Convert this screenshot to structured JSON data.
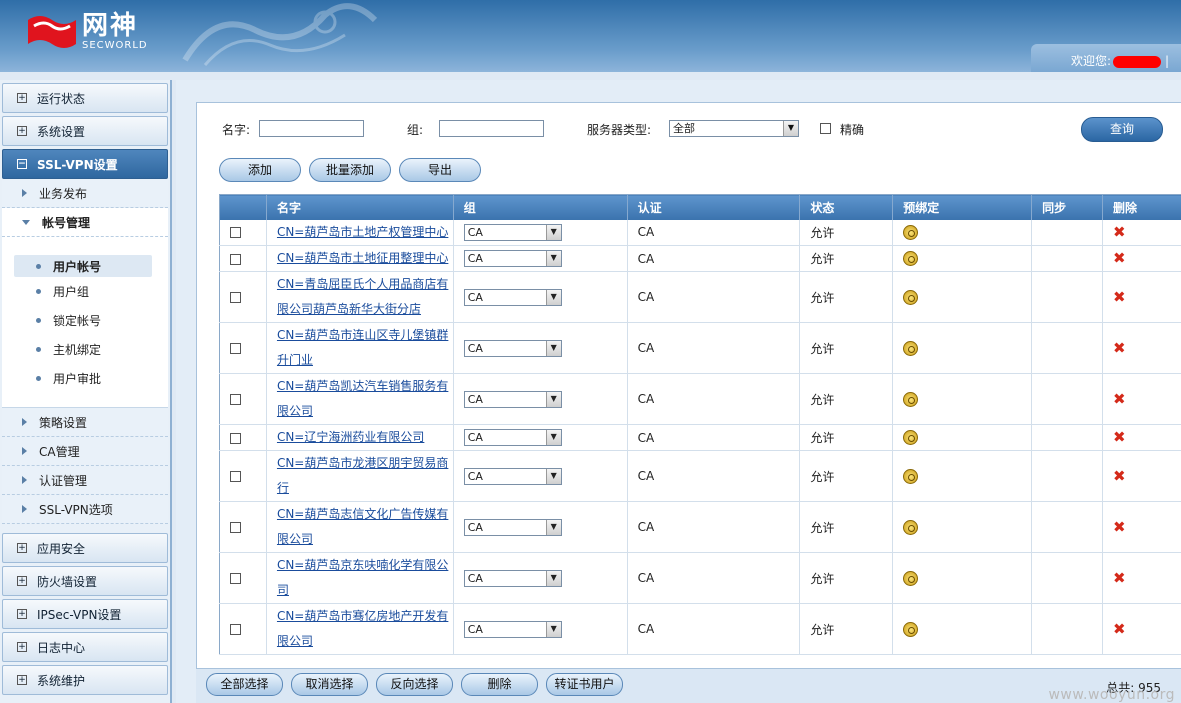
{
  "header": {
    "logo_cn": "网神",
    "logo_en": "SECWORLD",
    "welcome": "欢迎您:",
    "sep": "|"
  },
  "sidebar": {
    "groups_top": [
      {
        "label": "运行状态"
      },
      {
        "label": "系统设置"
      },
      {
        "label": "SSL-VPN设置"
      }
    ],
    "sub_top": [
      {
        "label": "业务发布"
      },
      {
        "label": "帐号管理"
      }
    ],
    "leaves": [
      {
        "label": "用户帐号"
      },
      {
        "label": "用户组"
      },
      {
        "label": "锁定帐号"
      },
      {
        "label": "主机绑定"
      },
      {
        "label": "用户审批"
      }
    ],
    "sub_bottom": [
      {
        "label": "策略设置"
      },
      {
        "label": "CA管理"
      },
      {
        "label": "认证管理"
      },
      {
        "label": "SSL-VPN选项"
      }
    ],
    "groups_bottom": [
      {
        "label": "应用安全"
      },
      {
        "label": "防火墙设置"
      },
      {
        "label": "IPSec-VPN设置"
      },
      {
        "label": "日志中心"
      },
      {
        "label": "系统维护"
      }
    ]
  },
  "search": {
    "name_label": "名字:",
    "group_label": "组:",
    "server_type_label": "服务器类型:",
    "server_type_value": "全部",
    "exact_label": "精确",
    "query_button": "查询"
  },
  "toolbar": {
    "add": "添加",
    "batch_add": "批量添加",
    "export": "导出"
  },
  "table": {
    "headers": [
      "名字",
      "组",
      "认证",
      "状态",
      "预绑定",
      "同步",
      "删除"
    ],
    "rows": [
      {
        "name_l1": "CN=葫芦岛市土地产权管理中心",
        "name_l2": "",
        "group": "CA",
        "auth": "CA",
        "status": "允许"
      },
      {
        "name_l1": "CN=葫芦岛市土地征用整理中心",
        "name_l2": "",
        "group": "CA",
        "auth": "CA",
        "status": "允许"
      },
      {
        "name_l1": "CN=青岛屈臣氏个人用品商店有",
        "name_l2": "限公司葫芦岛新华大街分店",
        "group": "CA",
        "auth": "CA",
        "status": "允许"
      },
      {
        "name_l1": "CN=葫芦岛市连山区寺儿堡镇群",
        "name_l2": "升门业",
        "group": "CA",
        "auth": "CA",
        "status": "允许"
      },
      {
        "name_l1": "CN=葫芦岛凯达汽车销售服务有",
        "name_l2": "限公司",
        "group": "CA",
        "auth": "CA",
        "status": "允许"
      },
      {
        "name_l1": "CN=辽宁海洲药业有限公司",
        "name_l2": "",
        "group": "CA",
        "auth": "CA",
        "status": "允许"
      },
      {
        "name_l1": "CN=葫芦岛市龙港区朋宇贸易商",
        "name_l2": "行",
        "group": "CA",
        "auth": "CA",
        "status": "允许"
      },
      {
        "name_l1": "CN=葫芦岛志信文化广告传媒有",
        "name_l2": "限公司",
        "group": "CA",
        "auth": "CA",
        "status": "允许"
      },
      {
        "name_l1": "CN=葫芦岛京东呋喃化学有限公",
        "name_l2": "司",
        "group": "CA",
        "auth": "CA",
        "status": "允许"
      },
      {
        "name_l1": "CN=葫芦岛市骞亿房地产开发有",
        "name_l2": "限公司",
        "group": "CA",
        "auth": "CA",
        "status": "允许"
      }
    ]
  },
  "footer": {
    "select_all": "全部选择",
    "cancel_select": "取消选择",
    "invert_select": "反向选择",
    "delete": "删除",
    "to_cert_user": "转证书用户",
    "total": "总共: 955"
  },
  "watermark": "www.wooyun.org",
  "colors": {
    "header": "#3a78b2",
    "accent": "#2f679f",
    "link": "#1a4c9c",
    "delete": "#d42a1a",
    "logo_red": "#e0141e"
  }
}
